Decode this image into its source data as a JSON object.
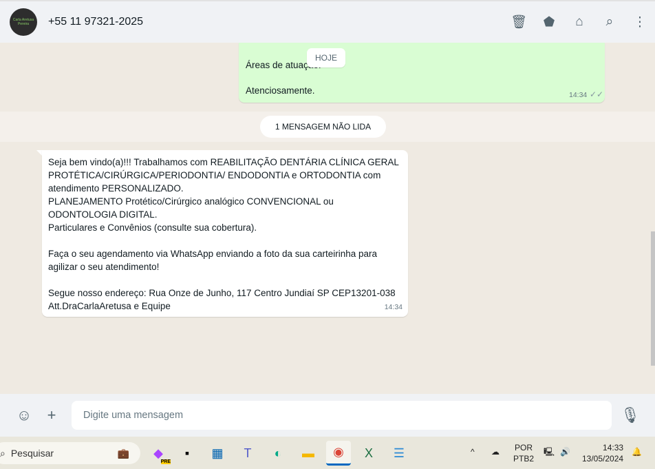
{
  "header": {
    "avatar_text": "Carla Aretusa Pereira",
    "title": "+55 11 97321-2025",
    "icons": [
      "delete-icon",
      "label-icon",
      "store-icon",
      "search-icon",
      "menu-icon"
    ]
  },
  "chat": {
    "outgoing": {
      "line1": "Áreas de atuação:",
      "line2": "Atenciosamente.",
      "time": "14:34",
      "status": "read"
    },
    "date_chip": "HOJE",
    "unread": "1 MENSAGEM NÃO LIDA",
    "incoming": {
      "text": "Seja bem vindo(a)!!! Trabalhamos com REABILITAÇÃO DENTÁRIA CLÍNICA GERAL\nPROTÉTICA/CIRÚRGICA/PERIODONTIA/ ENDODONTIA e ORTODONTIA com\natendimento PERSONALIZADO.\nPLANEJAMENTO Protético/Cirúrgico analógico CONVENCIONAL ou\nODONTOLOGIA DIGITAL.\nParticulares e Convênios (consulte sua cobertura).\n\nFaça o seu agendamento via WhatsApp enviando a foto da sua carteirinha para\nagilizar o seu atendimento!\n\nSegue nosso endereço: Rua Onze de Junho, 117 Centro Jundiaí SP CEP13201-038\nAtt.DraCarlaAretusa e Equipe",
      "time": "14:34"
    }
  },
  "composer": {
    "placeholder": "Digite uma mensagem"
  },
  "taskbar": {
    "search": "Pesquisar",
    "lang1": "POR",
    "lang2": "PTB2",
    "time": "14:33",
    "date": "13/05/2024",
    "copilot_badge": "PRE"
  }
}
